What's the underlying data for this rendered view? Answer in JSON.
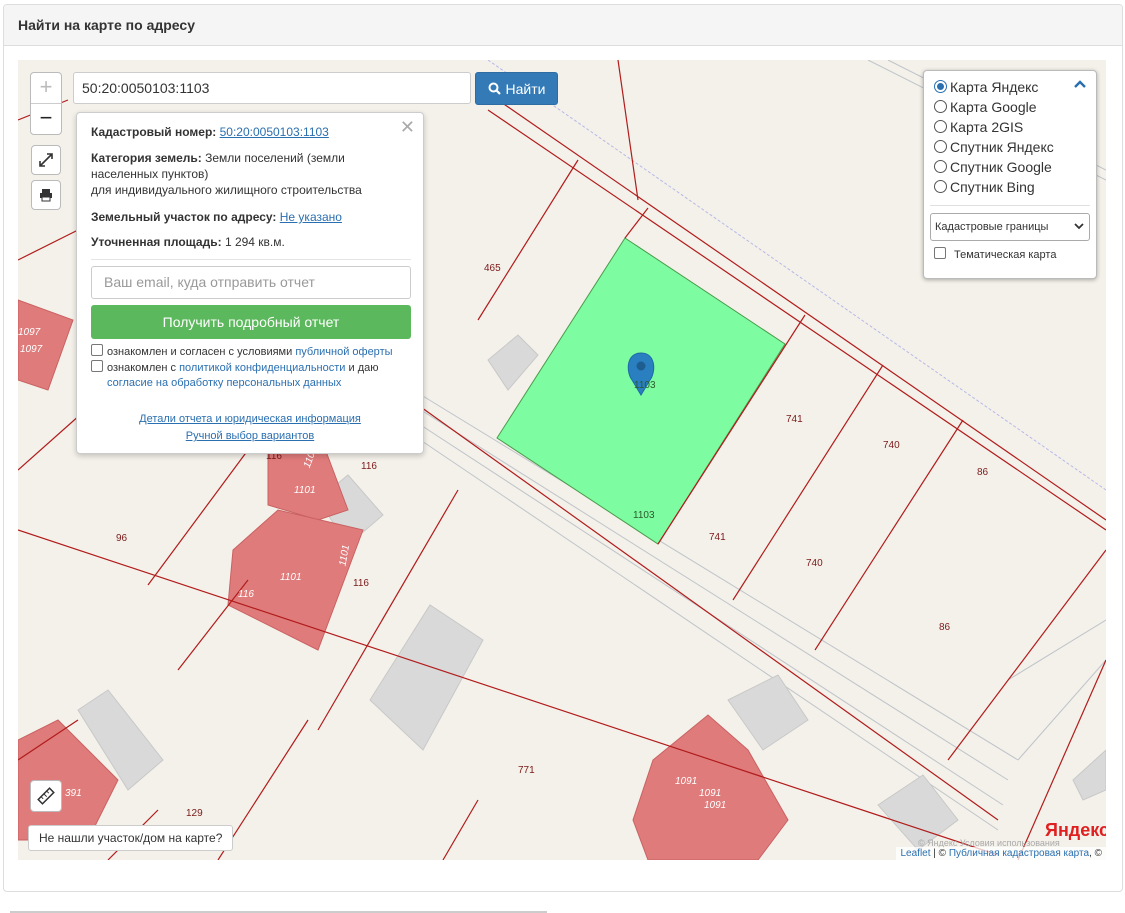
{
  "panel": {
    "title": "Найти на карте по адресу"
  },
  "search": {
    "value": "50:20:0050103:1103",
    "button_label": "Найти"
  },
  "popup": {
    "cadastral_label": "Кадастровый номер:",
    "cadastral_value": "50:20:0050103:1103",
    "category_label": "Категория земель:",
    "category_value": "Земли поселений (земли населенных пунктов)",
    "category_use": "для индивидуального жилищного строительства",
    "address_label": "Земельный участок по адресу:",
    "address_value": "Не указано",
    "area_label": "Уточненная площадь:",
    "area_value": "1 294 кв.м.",
    "email_placeholder": "Ваш email, куда отправить отчет",
    "report_button": "Получить подробный отчет",
    "check1_text": "ознакомлен и согласен с условиями",
    "check1_link": "публичной оферты",
    "check2_text": "ознакомлен с",
    "check2_link1": "политикой конфиденциальности",
    "check2_mid": "и даю",
    "check2_link2": "согласие на обработку персональных данных",
    "details_link": "Детали отчета и юридическая информация",
    "manual_link": "Ручной выбор вариантов"
  },
  "layers": {
    "options": [
      "Карта Яндекс",
      "Карта Google",
      "Карта 2GIS",
      "Спутник Яндекс",
      "Спутник Google",
      "Спутник Bing"
    ],
    "selected_index": 0,
    "overlay_select": "Кадастровые границы",
    "thematic_label": "Тематическая карта"
  },
  "map_labels": {
    "p465": "465",
    "p1103a": "1103",
    "p1103b": "1103",
    "p741a": "741",
    "p741b": "741",
    "p740a": "740",
    "p740b": "740",
    "p86a": "86",
    "p86b": "86",
    "p96": "96",
    "p116a": "116",
    "p116b": "116",
    "p116c": "116",
    "p116d": "116",
    "p1101a": "1101",
    "p1101b": "1101",
    "p1101c": "1101",
    "p1101d": "1101",
    "p1097a": "1097",
    "p1097b": "1097",
    "p771": "771",
    "p129": "129",
    "p391": "391",
    "p1091a": "1091",
    "p1091b": "1091",
    "p1091c": "1091"
  },
  "not_found_button": "Не нашли участок/дом на карте?",
  "attribution": {
    "leaflet": "Leaflet",
    "sep": " | © ",
    "pkk": "Публичная кадастровая карта",
    "copy": ", ©"
  },
  "yandex_terms": "© Яндекс  Условия использования",
  "yandex_logo": {
    "y": "Я",
    "rest": "ндекс"
  },
  "colors": {
    "parcel_fill": "#7dfca2",
    "building_red": "#e07b7b",
    "boundary": "#b11c1c",
    "accent": "#337ab7",
    "report_green": "#5cb85c"
  }
}
